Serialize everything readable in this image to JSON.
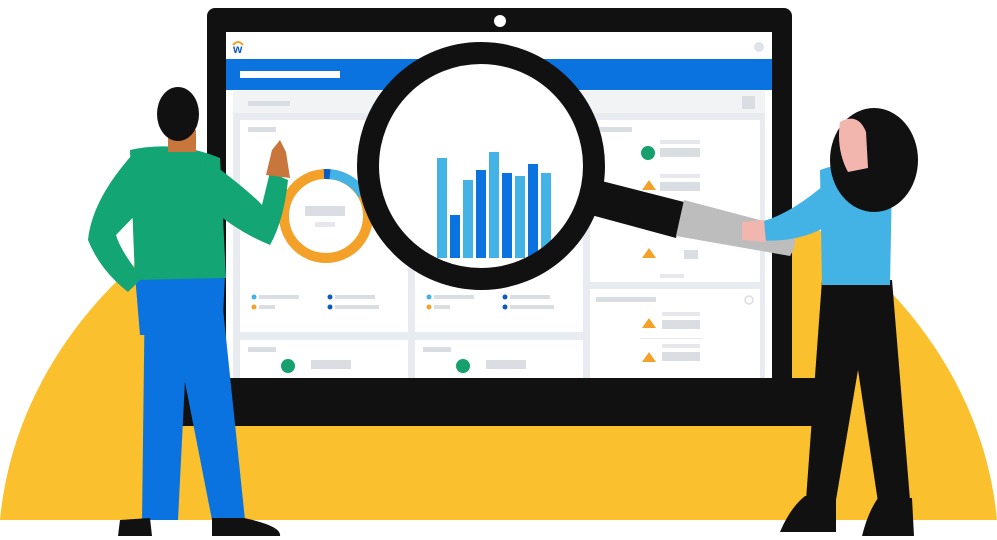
{
  "brand": {
    "logo_letter": "w"
  },
  "colors": {
    "background": "#ffffff",
    "sun_yellow": "#FBC02D",
    "monitor_frame": "#111111",
    "app_header_blue": "#0A73E0",
    "panel_gray": "#E8EBEF",
    "card_white": "#ffffff",
    "placeholder_gray": "#DADDE2",
    "donut_orange": "#F4A12A",
    "donut_light_blue": "#43B3E6",
    "donut_dark_blue": "#0A5CC2",
    "bar_light_blue": "#43B3E6",
    "bar_dark_blue": "#0A73E0",
    "status_green": "#16A06E",
    "warning_orange": "#F4A12A",
    "man_shirt": "#13A574",
    "man_pants": "#0A73E0",
    "man_skin": "#C8763C",
    "woman_top": "#43B3E6",
    "woman_skin": "#F2B6AE",
    "dark": "#111111",
    "magnifier_handle": "#BDBDBD"
  },
  "icons": {
    "magnifier": "magnifying-glass-icon",
    "status_dot": "green-circle-icon",
    "warning": "warning-triangle-icon",
    "settings": "circle-icon"
  },
  "chart_data": {
    "type": "bar",
    "categories": [
      "",
      "",
      "",
      "",
      "",
      "",
      "",
      "",
      ""
    ],
    "values": [
      100,
      43,
      78,
      88,
      106,
      85,
      82,
      94,
      85
    ],
    "title": "",
    "xlabel": "",
    "ylabel": "",
    "grid": false,
    "legend": "none"
  },
  "donut_data": {
    "type": "pie",
    "values": [
      82,
      16,
      2
    ],
    "title": ""
  }
}
